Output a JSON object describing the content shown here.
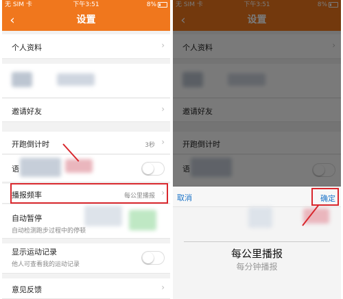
{
  "status": {
    "carrier": "无 SIM 卡",
    "time": "下午3:51",
    "battery": "8%"
  },
  "nav": {
    "back": "‹",
    "title": "设置"
  },
  "settings": {
    "profile": "个人资料",
    "invite": "邀请好友",
    "countdown": {
      "label": "开跑倒计时",
      "value": "3秒"
    },
    "partial_label": "语",
    "broadcast": {
      "label": "播报频率",
      "value": "每公里播报"
    },
    "auto_pause": {
      "label": "自动暂停",
      "sub": "自动检测跑步过程中的停顿"
    },
    "show_record": {
      "label": "显示运动记录",
      "sub": "他人可查看我的运动记录"
    },
    "feedback": "意见反馈"
  },
  "picker": {
    "cancel": "取消",
    "confirm": "确定",
    "options": [
      "每公里播报",
      "每分钟播报"
    ]
  },
  "chevron": "›",
  "colors": {
    "accent": "#f0771d",
    "highlight": "#d8262c",
    "link": "#1a73c8"
  }
}
